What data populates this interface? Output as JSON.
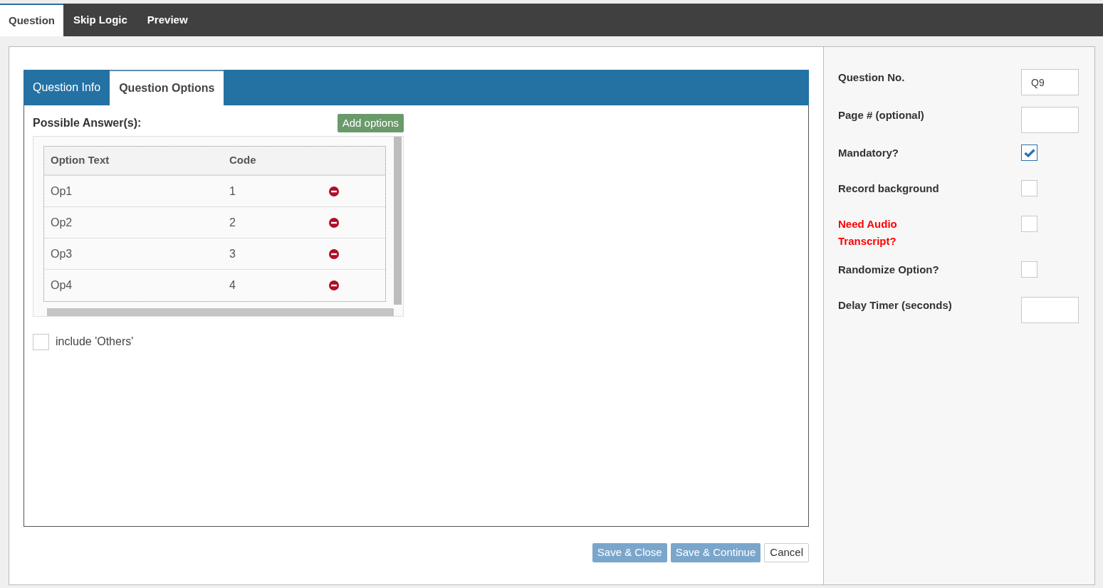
{
  "top_tabs": [
    {
      "label": "Question",
      "selected": true
    },
    {
      "label": "Skip Logic",
      "selected": false
    },
    {
      "label": "Preview",
      "selected": false
    }
  ],
  "sub_tabs": [
    {
      "label": "Question Info",
      "selected": false
    },
    {
      "label": "Question Options",
      "selected": true
    }
  ],
  "answers": {
    "title": "Possible Answer(s):",
    "add_button": "Add options",
    "columns": [
      "Option Text",
      "Code"
    ],
    "rows": [
      {
        "text": "Op1",
        "code": "1"
      },
      {
        "text": "Op2",
        "code": "2"
      },
      {
        "text": "Op3",
        "code": "3"
      },
      {
        "text": "Op4",
        "code": "4"
      }
    ],
    "include_others": {
      "label": "include 'Others'",
      "checked": false
    }
  },
  "buttons": [
    {
      "label": "Save & Close",
      "kind": "primary"
    },
    {
      "label": "Save & Continue",
      "kind": "primary"
    },
    {
      "label": "Cancel",
      "kind": "default"
    }
  ],
  "settings": [
    {
      "label": "Question No.",
      "kind": "text",
      "value": "Q9",
      "highlight": false
    },
    {
      "label": "Page # (optional)",
      "kind": "text",
      "highlight": false
    },
    {
      "label": "Mandatory?",
      "kind": "checkbox",
      "checked": true,
      "highlight": false
    },
    {
      "label": "Record background",
      "kind": "checkbox",
      "checked": false,
      "highlight": false
    },
    {
      "label": "Need Audio Transcript?",
      "kind": "checkbox",
      "checked": false,
      "highlight": true
    },
    {
      "label": "Randomize Option?",
      "kind": "checkbox",
      "checked": false,
      "highlight": false
    },
    {
      "label": "Delay Timer (seconds)",
      "kind": "text",
      "highlight": false
    }
  ]
}
